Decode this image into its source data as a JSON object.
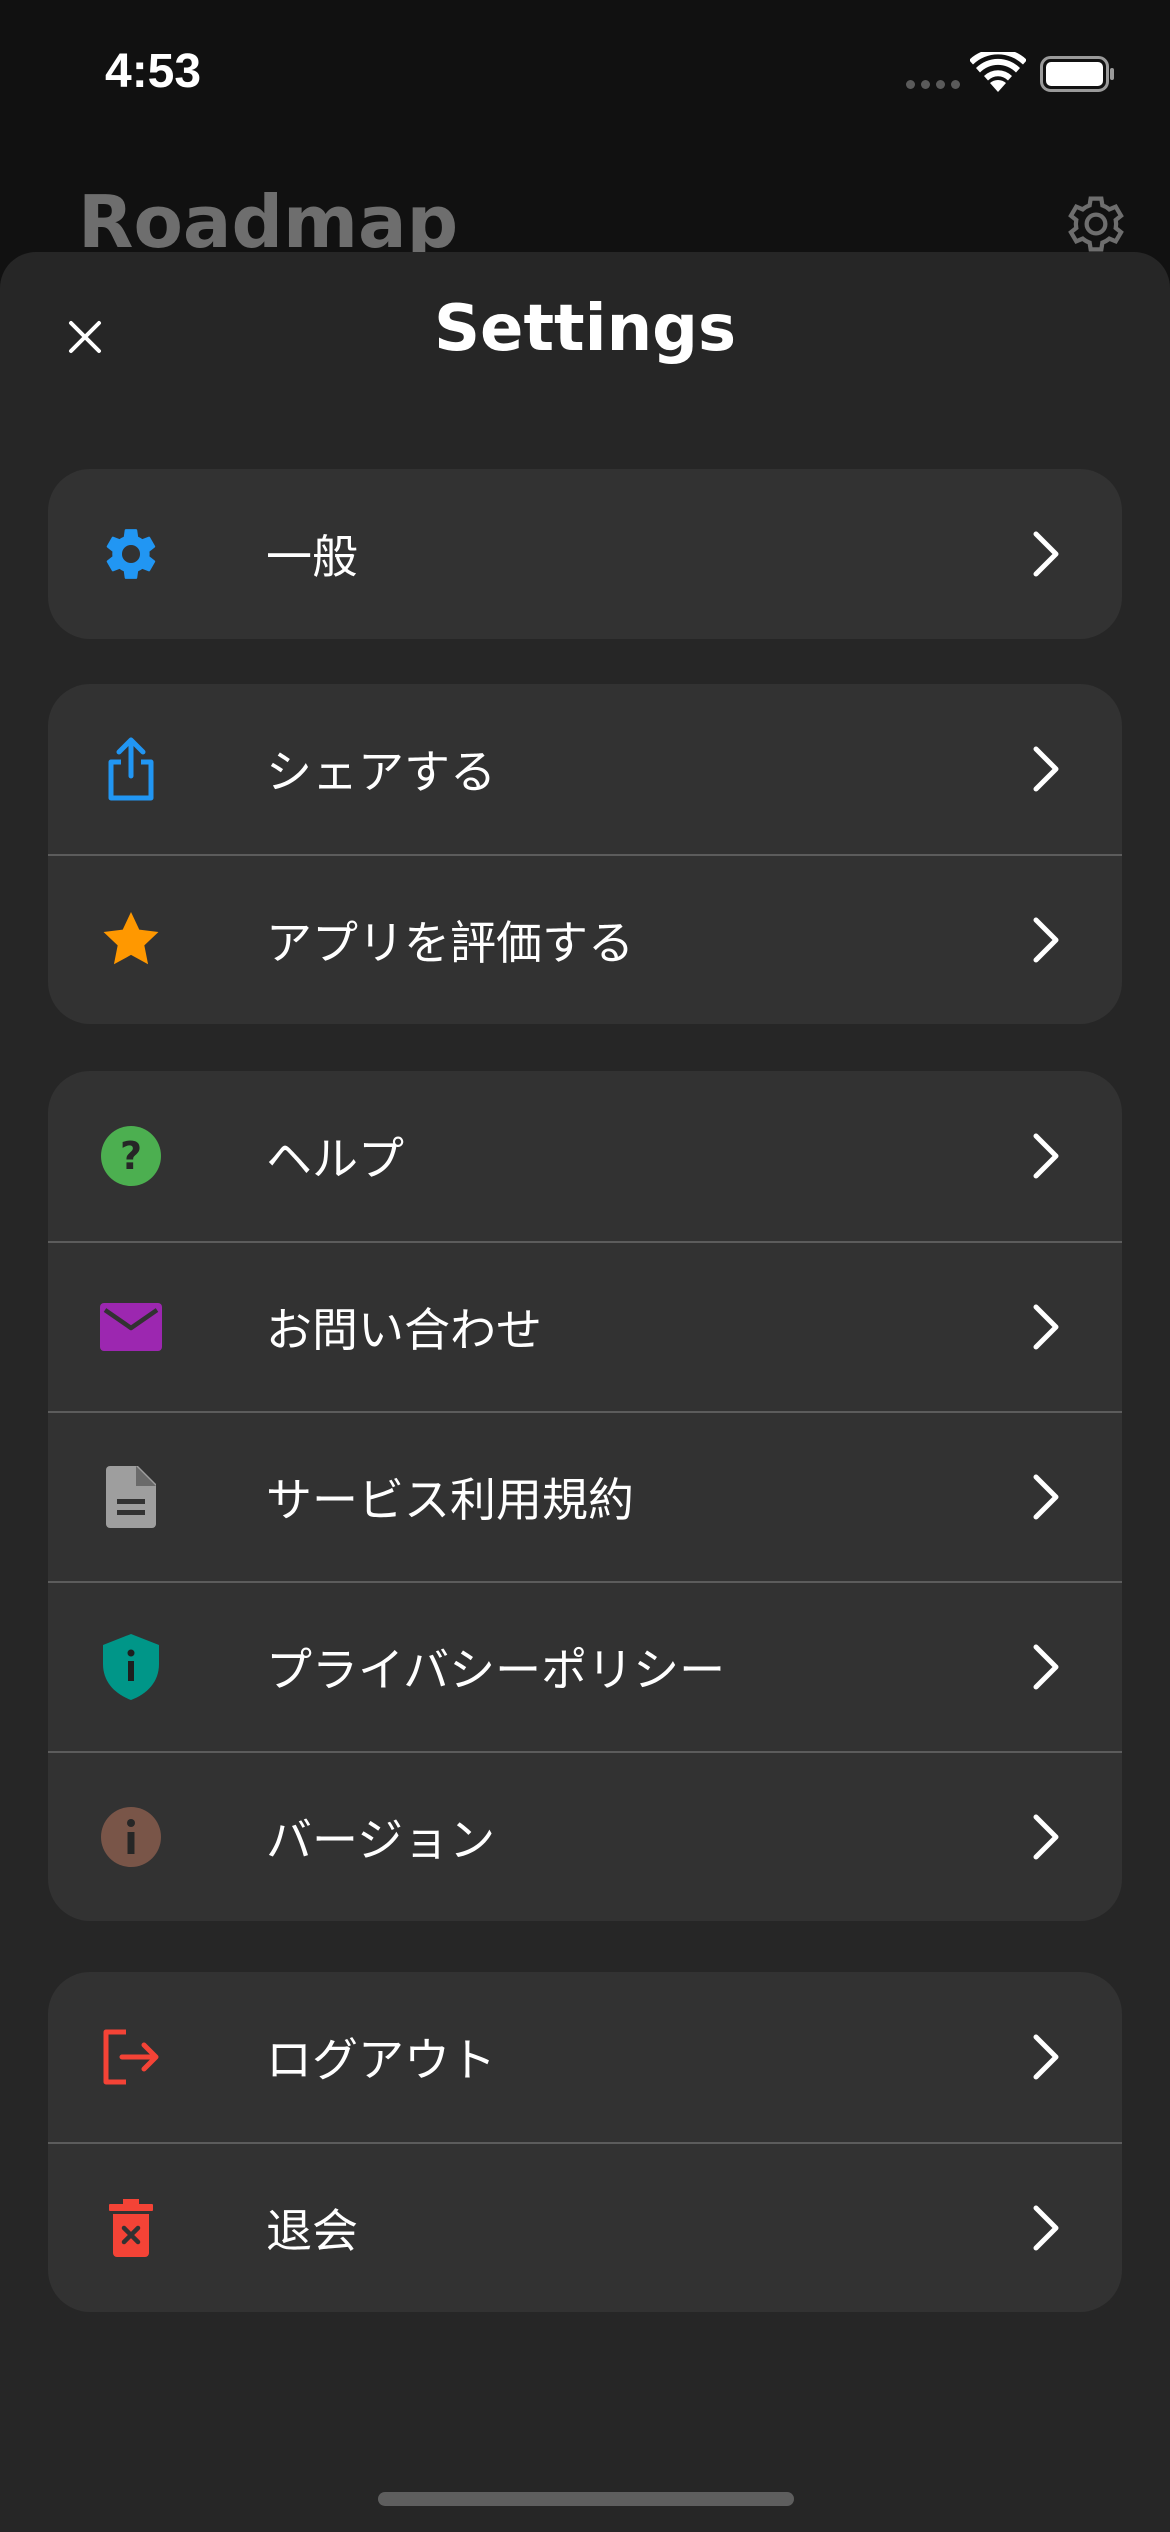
{
  "status_bar": {
    "time": "4:53"
  },
  "background": {
    "title": "Roadmap"
  },
  "sheet": {
    "title": "Settings"
  },
  "groups": [
    {
      "items": [
        {
          "label": "一般",
          "icon": "gear-icon",
          "color": "#2196F3"
        }
      ]
    },
    {
      "items": [
        {
          "label": "シェアする",
          "icon": "share-icon",
          "color": "#2196F3"
        },
        {
          "label": "アプリを評価する",
          "icon": "star-icon",
          "color": "#FF9800"
        }
      ]
    },
    {
      "items": [
        {
          "label": "ヘルプ",
          "icon": "help-icon",
          "color": "#4CAF50"
        },
        {
          "label": "お問い合わせ",
          "icon": "mail-icon",
          "color": "#9C27B0"
        },
        {
          "label": "サービス利用規約",
          "icon": "document-icon",
          "color": "#9E9E9E"
        },
        {
          "label": "プライバシーポリシー",
          "icon": "shield-icon",
          "color": "#009688"
        },
        {
          "label": "バージョン",
          "icon": "info-icon",
          "color": "#795548"
        }
      ]
    },
    {
      "items": [
        {
          "label": "ログアウト",
          "icon": "logout-icon",
          "color": "#F44336"
        },
        {
          "label": "退会",
          "icon": "trash-icon",
          "color": "#F44336"
        }
      ]
    }
  ]
}
